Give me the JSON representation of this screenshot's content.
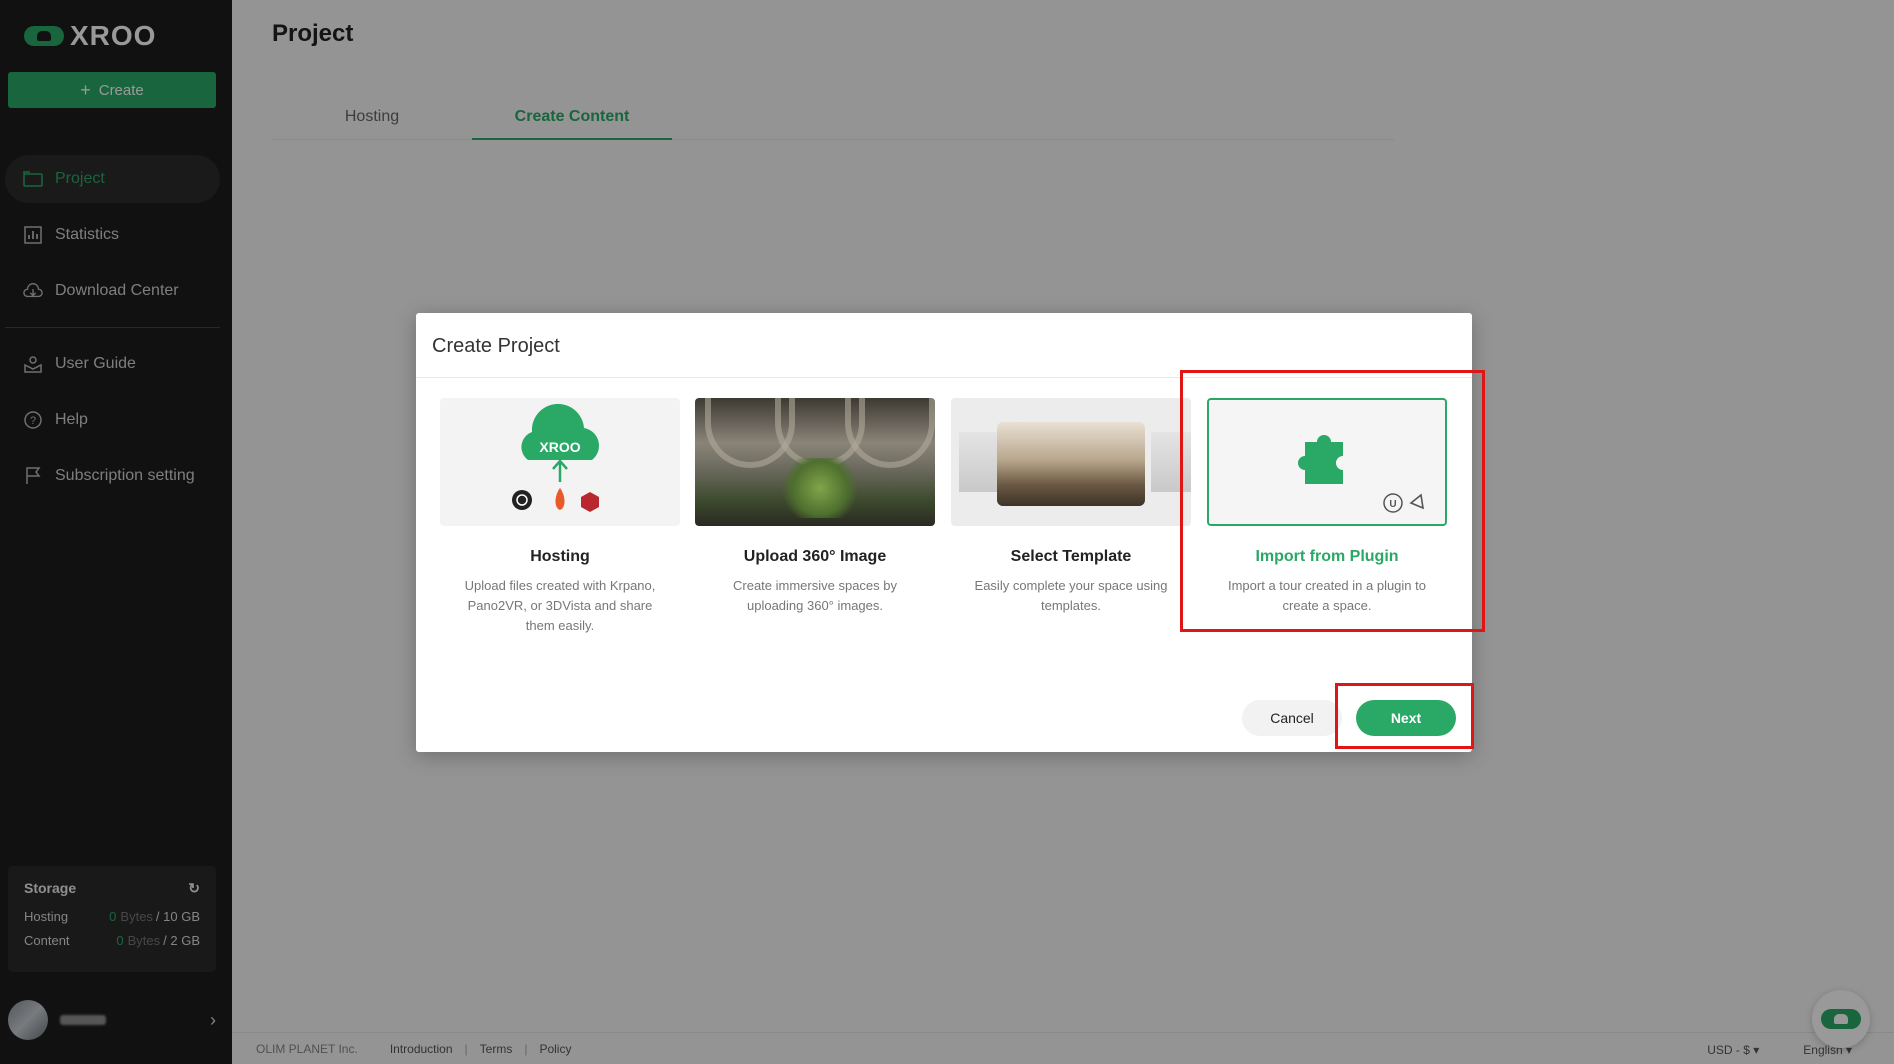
{
  "app": {
    "logo_text": "XROO"
  },
  "sidebar": {
    "create_label": "Create",
    "items": [
      {
        "label": "Project",
        "icon": "folder-icon",
        "active": true
      },
      {
        "label": "Statistics",
        "icon": "chart-icon"
      },
      {
        "label": "Download Center",
        "icon": "cloud-download-icon"
      },
      {
        "label": "User Guide",
        "icon": "guide-icon"
      },
      {
        "label": "Help",
        "icon": "help-icon"
      },
      {
        "label": "Subscription setting",
        "icon": "flag-icon"
      }
    ],
    "storage": {
      "title": "Storage",
      "hosting_label": "Hosting",
      "hosting_used": "0",
      "hosting_unit": "Bytes",
      "hosting_total": "/ 10 GB",
      "content_label": "Content",
      "content_used": "0",
      "content_unit": "Bytes",
      "content_total": "/ 2 GB"
    }
  },
  "main": {
    "title": "Project",
    "tabs": [
      {
        "label": "Hosting"
      },
      {
        "label": "Create Content",
        "active": true
      }
    ]
  },
  "modal": {
    "title": "Create Project",
    "cards": [
      {
        "title": "Hosting",
        "desc": "Upload files created with Krpano, Pano2VR, or 3DVista and share them easily.",
        "badge": "XROO"
      },
      {
        "title": "Upload 360° Image",
        "desc": "Create immersive spaces by uploading 360° images."
      },
      {
        "title": "Select Template",
        "desc": "Easily complete your space using templates."
      },
      {
        "title": "Import from Plugin",
        "desc": "Import a tour created in a plugin to create a space.",
        "selected": true
      }
    ],
    "cancel_label": "Cancel",
    "next_label": "Next"
  },
  "footer": {
    "company": "OLIM PLANET Inc.",
    "links": [
      "Introduction",
      "Terms",
      "Policy"
    ],
    "currency": "USD - $",
    "language": "English"
  },
  "colors": {
    "accent": "#2aa866",
    "highlight": "#e01515",
    "sidebar_bg": "#1d1d1d"
  }
}
